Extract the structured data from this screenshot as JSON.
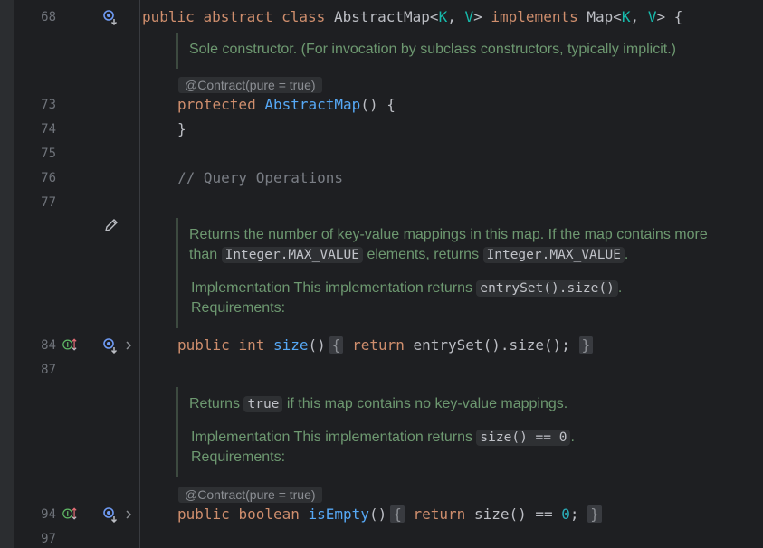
{
  "line_numbers": {
    "l68": "68",
    "l73": "73",
    "l74": "74",
    "l75": "75",
    "l76": "76",
    "l77": "77",
    "l84": "84",
    "l87": "87",
    "l94": "94",
    "l97": "97"
  },
  "class_decl": {
    "kw_public": "public",
    "kw_abstract": "abstract",
    "kw_class": "class",
    "name": "AbstractMap",
    "lt": "<",
    "tp_k": "K",
    "comma": ", ",
    "tp_v": "V",
    "gt": ">",
    "kw_implements": "implements",
    "iface": "Map",
    "brace": " {"
  },
  "doc1": {
    "text": "Sole constructor. (For invocation by subclass constructors, typically implicit.)"
  },
  "anno1": {
    "text": "@Contract(pure = true)"
  },
  "ctor": {
    "kw_protected": "protected",
    "name": "AbstractMap",
    "parens": "() {",
    "close": "}"
  },
  "comment76": {
    "text": "// Query Operations"
  },
  "doc2": {
    "p1a": "Returns the number of key-value mappings in this map. If the map contains more",
    "p1b": "than",
    "code1": "Integer.MAX_VALUE",
    "p1c": "elements, returns",
    "code2": "Integer.MAX_VALUE",
    "p1d": ".",
    "impl": "Implementation This implementation returns",
    "code3": "entrySet().size()",
    "impl_end": ".",
    "req": "Requirements:"
  },
  "size_method": {
    "kw_public": "public",
    "kw_int": "int",
    "name": "size",
    "parens": "()",
    "fold_open": "{",
    "kw_return": "return",
    "body": "entrySet().size();",
    "fold_close": "}"
  },
  "doc3": {
    "p1a": "Returns",
    "code1": "true",
    "p1b": "if this map contains no key-value mappings.",
    "impl": "Implementation This implementation returns",
    "code2": "size() == 0",
    "impl_end": ".",
    "req": "Requirements:"
  },
  "anno2": {
    "text": "@Contract(pure = true)"
  },
  "isempty_method": {
    "kw_public": "public",
    "kw_boolean": "boolean",
    "name": "isEmpty",
    "parens": "()",
    "fold_open": "{",
    "kw_return": "return",
    "body_a": "size() == ",
    "zero": "0",
    "semi": ";",
    "fold_close": "}"
  },
  "icons": {
    "find_usages": "magnifier-usages-icon",
    "edit_doc": "pencil-icon",
    "implement_marker": "implementing-method-icon",
    "expand": "chevron-right-icon"
  },
  "colors": {
    "background": "#1e1f22",
    "keyword": "#cf8e6d",
    "type_param": "#16baac",
    "function": "#56a8f5",
    "doc_text": "#6d9870",
    "line_number": "#6f737a"
  }
}
